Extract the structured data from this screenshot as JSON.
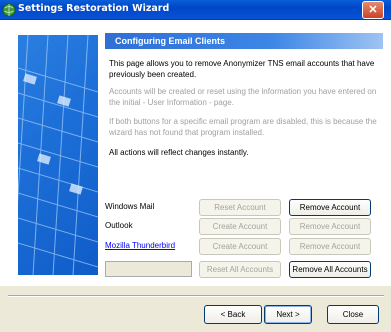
{
  "window": {
    "title": "Settings Restoration Wizard",
    "close_glyph": "✕"
  },
  "header": {
    "title": "Configuring Email Clients"
  },
  "text": {
    "intro": "This page allows you to remove Anonymizer TNS email accounts that have previously been created.",
    "info_created": "Accounts will be created or reset using the information you have entered on the initial - User Information - page.",
    "info_disabled": "If both buttons for a specific email program are disabled, this is because the wizard has not found that program installed.",
    "instant": "All actions will reflect changes instantly."
  },
  "clients": [
    {
      "name": "Windows Mail",
      "left_button": "Reset Account",
      "right_button": "Remove Account"
    },
    {
      "name": "Outlook",
      "left_button": "Create Account",
      "right_button": "Remove Account"
    },
    {
      "name": "Mozilla Thunderbird",
      "left_button": "Create Account",
      "right_button": "Remove Account"
    }
  ],
  "bulk": {
    "textbox_value": "",
    "reset_all": "Reset All Accounts",
    "remove_all": "Remove All Accounts"
  },
  "nav": {
    "back": "< Back",
    "next": "Next >",
    "close": "Close"
  },
  "icons": {
    "app": "wizard-globe-icon",
    "close": "close-icon"
  },
  "colors": {
    "titlebar": "#0046c8",
    "header_band": "#2f6fd6",
    "link": "#0000ff",
    "disabled_text": "#a4a39c"
  }
}
